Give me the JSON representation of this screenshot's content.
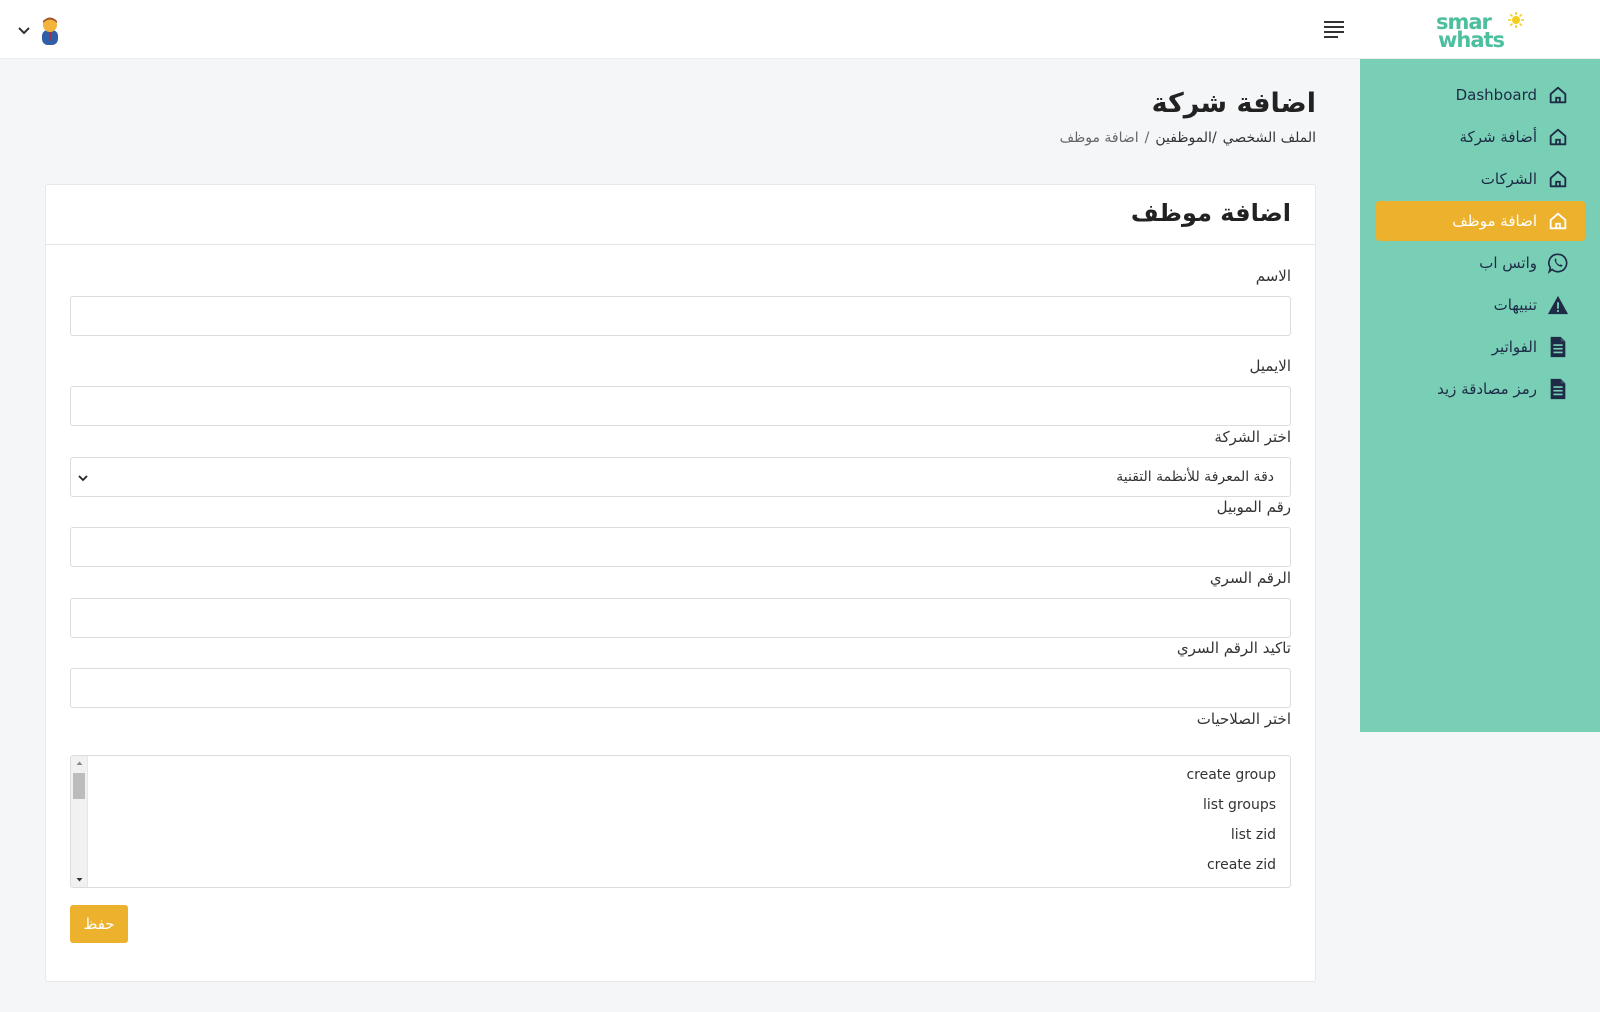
{
  "brand": {
    "line1": "smar",
    "line2": "whats",
    "accent": "#4cbf9e",
    "sun_color": "#f5cf1d"
  },
  "colors": {
    "sidebar_bg": "#79cfb5",
    "active_bg": "#ecb22e",
    "nav_text": "#1d2b46"
  },
  "sidebar": {
    "items": [
      {
        "label": "Dashboard",
        "icon": "home-icon"
      },
      {
        "label": "أضافة شركة",
        "icon": "home-icon"
      },
      {
        "label": "الشركات",
        "icon": "home-icon"
      },
      {
        "label": "اضافة موظف",
        "icon": "home-icon",
        "active": true
      },
      {
        "label": "واتس اب",
        "icon": "whatsapp-icon"
      },
      {
        "label": "تنبيهات",
        "icon": "warning-icon"
      },
      {
        "label": "الفواتير",
        "icon": "document-icon"
      },
      {
        "label": "رمز مصادقة زيد",
        "icon": "document-icon"
      }
    ]
  },
  "header": {
    "page_title": "اضافة شركة"
  },
  "breadcrumb": {
    "item1": "الملف الشخصي",
    "item2": "/الموظفين",
    "sep": "/",
    "current": "اضافة موظف"
  },
  "card": {
    "title": "اضافة موظف"
  },
  "form": {
    "name_label": "الاسم",
    "email_label": "الايميل",
    "company_label": "اختر الشركة",
    "company_value": "دقة المعرفة للأنظمة التقنية",
    "mobile_label": "رقم الموبيل",
    "password_label": "الرقم السري",
    "confirm_label": "تاكيد الرقم السري",
    "permissions_label": "اختر الصلاحيات",
    "permissions": [
      "create group",
      "list groups",
      "list zid",
      "create zid"
    ],
    "save_label": "حفظ"
  }
}
